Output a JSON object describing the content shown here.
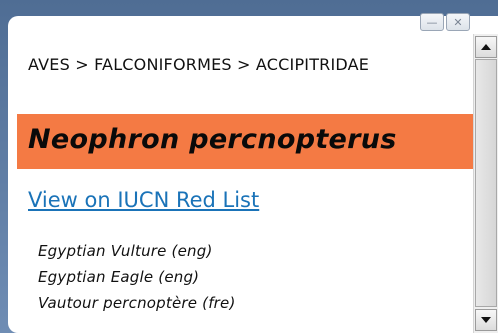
{
  "window_controls": {
    "minimize_icon": "minimize-icon",
    "close_icon": "close-icon",
    "minimize_glyph": "—",
    "close_glyph": "✕"
  },
  "breadcrumb": {
    "text": "AVES > FALCONIFORMES > ACCIPITRIDAE"
  },
  "species": {
    "scientific_name": "Neophron percnopterus",
    "title_bg_color": "#f47a44"
  },
  "links": {
    "iucn_label": "View on IUCN Red List",
    "link_color": "#1a73b8"
  },
  "common_names": [
    "Egyptian Vulture (eng)",
    "Egyptian Eagle (eng)",
    "Vautour percnoptère (fre)"
  ],
  "scrollbar": {
    "up_icon": "scroll-up-arrow-icon",
    "down_icon": "scroll-down-arrow-icon",
    "position_fraction": 0.0
  }
}
